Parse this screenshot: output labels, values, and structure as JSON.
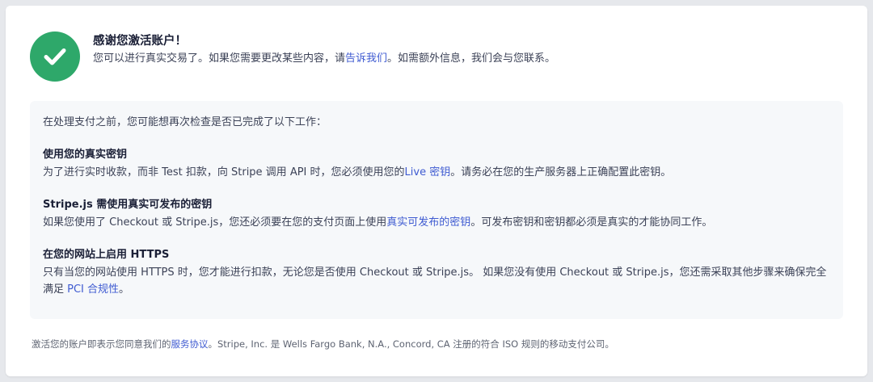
{
  "header": {
    "title": "感谢您激活账户！",
    "subtitle_pre": "您可以进行真实交易了。如果您需要更改某些内容，请",
    "subtitle_link": "告诉我们",
    "subtitle_post": "。如需额外信息，我们会与您联系。",
    "icon": "check-circle-icon",
    "icon_color": "#2ea86a"
  },
  "panel": {
    "intro": "在处理支付之前，您可能想再次检查是否已完成了以下工作：",
    "sections": [
      {
        "title": "使用您的真实密钥",
        "body_pre": "为了进行实时收款，而非 Test 扣款，向 Stripe 调用 API 时，您必须使用您的",
        "link": "Live 密钥",
        "body_post": "。请务必在您的生产服务器上正确配置此密钥。"
      },
      {
        "title": "Stripe.js 需使用真实可发布的密钥",
        "body_pre": "如果您使用了 Checkout 或 Stripe.js，您还必须要在您的支付页面上使用",
        "link": "真实可发布的密钥",
        "body_post": "。可发布密钥和密钥都必须是真实的才能协同工作。"
      },
      {
        "title": "在您的网站上启用 HTTPS",
        "body_pre": "只有当您的网站使用 HTTPS 时，您才能进行扣款，无论您是否使用 Checkout 或 Stripe.js。 如果您没有使用 Checkout 或 Stripe.js，您还需采取其他步骤来确保完全满足 ",
        "link": "PCI 合规性",
        "body_post": "。"
      }
    ]
  },
  "footer": {
    "pre": "激活您的账户即表示您同意我们的",
    "link": "服务协议",
    "post": "。Stripe, Inc. 是 Wells Fargo Bank, N.A., Concord, CA 注册的符合 ISO 规则的移动支付公司。"
  },
  "colors": {
    "link": "#3f5bd1",
    "panel_bg": "#f6f8fa"
  }
}
